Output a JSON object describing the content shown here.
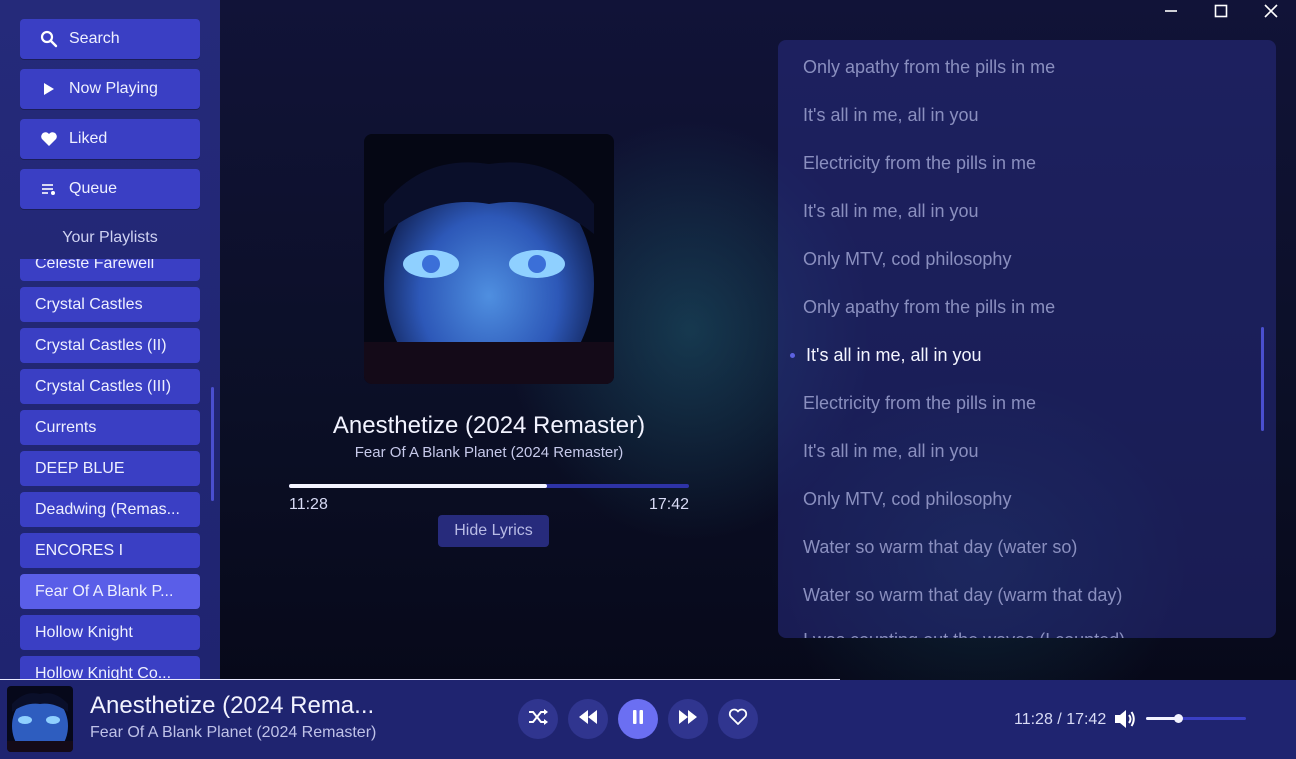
{
  "window": {
    "minimize": "minimize",
    "maximize": "maximize",
    "close": "close"
  },
  "sidebar": {
    "nav": [
      {
        "label": "Search",
        "icon": "search-icon"
      },
      {
        "label": "Now Playing",
        "icon": "play-icon"
      },
      {
        "label": "Liked",
        "icon": "heart-icon"
      },
      {
        "label": "Queue",
        "icon": "queue-icon"
      }
    ],
    "playlists_title": "Your Playlists",
    "playlists": [
      "Celeste Farewell",
      "Crystal Castles",
      "Crystal Castles (II)",
      "Crystal Castles (III)",
      "Currents",
      "DEEP BLUE",
      "Deadwing (Remas...",
      "ENCORES I",
      "Fear Of A Blank P...",
      "Hollow Knight",
      "Hollow Knight Co..."
    ],
    "active_playlist": "Fear Of A Blank P..."
  },
  "now_playing": {
    "title": "Anesthetize (2024 Remaster)",
    "album": "Fear Of A Blank Planet (2024 Remaster)",
    "elapsed": "11:28",
    "total": "17:42",
    "progress": 0.646,
    "hide_lyrics_label": "Hide Lyrics"
  },
  "lyrics": {
    "lines": [
      "Only apathy from the pills in me",
      "It's all in me, all in you",
      "Electricity from the pills in me",
      "It's all in me, all in you",
      "Only MTV, cod philosophy",
      "Only apathy from the pills in me",
      "It's all in me, all in you",
      "Electricity from the pills in me",
      "It's all in me, all in you",
      "Only MTV, cod philosophy",
      "Water so warm that day (water so)",
      "Water so warm that day (warm that day)",
      "I was counting out the waves (I counted)"
    ],
    "current_index": 6
  },
  "player_bar": {
    "title": "Anesthetize (2024 Rema...",
    "album": "Fear Of A Blank Planet (2024 Remaster)",
    "time": "11:28 / 17:42",
    "volume": 0.32,
    "controls": [
      "shuffle-icon",
      "previous-icon",
      "pause-icon",
      "next-icon",
      "heart-outline-icon"
    ]
  },
  "colors": {
    "sidebar": "#252a7a",
    "button": "#3a3fc4",
    "accent": "#6b6ff2",
    "active_playlist": "#5a5ee8",
    "lyric_dim": "#8a8fbf",
    "lyric_current": "#f4f5ff"
  }
}
